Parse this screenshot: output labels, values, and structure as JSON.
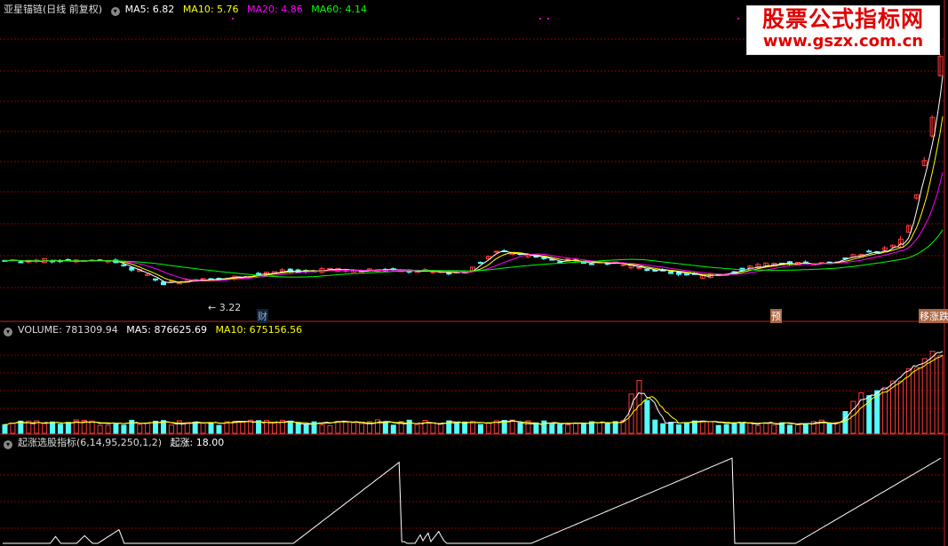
{
  "header": {
    "stock_name": "亚星锚链",
    "mode": "(日线 前复权)",
    "ma5": "MA5: 6.82",
    "ma10": "MA10: 5.76",
    "ma20": "MA20: 4.86",
    "ma60": "MA60: 4.14"
  },
  "volume_header": {
    "label": "VOLUME: 781309.94",
    "ma5": "MA5: 876625.69",
    "ma10": "MA10: 675156.56"
  },
  "indicator_header": {
    "label": "起涨选股指标(6,14,95,250,1,2)",
    "value": "起涨: 18.00"
  },
  "annotations": {
    "low_price": "3.22",
    "marker_cai": "财",
    "marker_yu": "预",
    "marker_right": "移涨跌"
  },
  "logo": {
    "line1": "股票公式指标网",
    "line2": "www.gszx.com.cn"
  },
  "colors": {
    "up": "#ff3b3b",
    "down": "#54fcfc",
    "ma5": "#ffffff",
    "ma10": "#ffff00",
    "ma20": "#ff00ff",
    "ma60": "#00ff00",
    "grid": "#8b0000",
    "indicator": "#ffffff"
  },
  "chart_data": [
    {
      "type": "candlestick",
      "title": "亚星锚链 (日线 前复权)",
      "series": [
        {
          "name": "MA5",
          "color": "#ffffff",
          "last": 6.82
        },
        {
          "name": "MA10",
          "color": "#ffff00",
          "last": 5.76
        },
        {
          "name": "MA20",
          "color": "#ff00ff",
          "last": 4.86
        },
        {
          "name": "MA60",
          "color": "#00ff00",
          "last": 4.14
        }
      ],
      "annotations": [
        {
          "text": "3.22",
          "note": "period low"
        }
      ],
      "price_points": [
        {
          "x": 0,
          "close": 4.0
        },
        {
          "x": 40,
          "close": 4.0
        },
        {
          "x": 50,
          "close": 3.7
        },
        {
          "x": 60,
          "close": 3.3
        },
        {
          "x": 75,
          "close": 3.4
        },
        {
          "x": 110,
          "close": 3.7
        },
        {
          "x": 150,
          "close": 3.7
        },
        {
          "x": 175,
          "close": 3.6
        },
        {
          "x": 185,
          "close": 4.3
        },
        {
          "x": 210,
          "close": 4.0
        },
        {
          "x": 230,
          "close": 3.9
        },
        {
          "x": 265,
          "close": 3.5
        },
        {
          "x": 290,
          "close": 3.9
        },
        {
          "x": 310,
          "close": 3.9
        },
        {
          "x": 340,
          "close": 4.5
        },
        {
          "x": 349,
          "close": 7.4
        },
        {
          "x": 352,
          "close": 8.8
        },
        {
          "x": 355,
          "close": 11.0
        }
      ]
    },
    {
      "type": "bar",
      "title": "VOLUME",
      "series": [
        {
          "name": "VOLUME",
          "last": 781309.94
        },
        {
          "name": "MA5",
          "last": 876625.69
        },
        {
          "name": "MA10",
          "last": 675156.56
        }
      ],
      "shape": "low volume until a spike near bar 240, then surge in the final 20 bars"
    },
    {
      "type": "line",
      "title": "起涨选股指标(6,14,95,250,1,2)",
      "series": [
        {
          "name": "起涨",
          "last": 18.0
        }
      ],
      "shape": "sawtooth ramps: peaks near bars 44, 150, 276, 355"
    }
  ]
}
